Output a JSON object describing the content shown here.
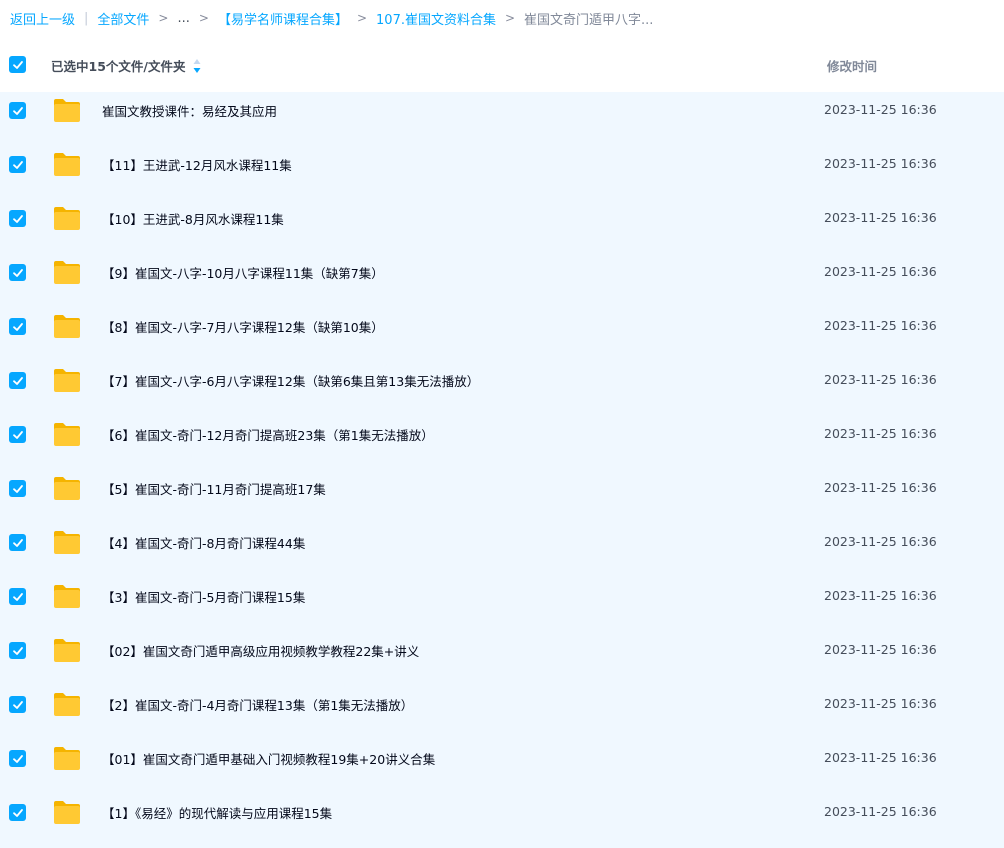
{
  "breadcrumb": {
    "back": "返回上一级",
    "sep": "|",
    "all_files": "全部文件",
    "ellipsis": "...",
    "crumb1": "【易学名师课程合集】",
    "crumb2": "107.崔国文资料合集",
    "current": "崔国文奇门遁甲八字...",
    "arrow": ">"
  },
  "header": {
    "selected_label": "已选中15个文件/文件夹",
    "time_column": "修改时间"
  },
  "colors": {
    "accent": "#06a7ff",
    "row_selected_bg": "#f0f8ff",
    "folder": "#ffc933"
  },
  "files": [
    {
      "name": "崔国文教授课件：易经及其应用",
      "time": "2023-11-25 16:36",
      "icon": "folder-icon"
    },
    {
      "name": "【11】王进武-12月风水课程11集",
      "time": "2023-11-25 16:36",
      "icon": "folder-icon"
    },
    {
      "name": "【10】王进武-8月风水课程11集",
      "time": "2023-11-25 16:36",
      "icon": "folder-icon"
    },
    {
      "name": "【9】崔国文-八字-10月八字课程11集（缺第7集）",
      "time": "2023-11-25 16:36",
      "icon": "folder-icon"
    },
    {
      "name": "【8】崔国文-八字-7月八字课程12集（缺第10集）",
      "time": "2023-11-25 16:36",
      "icon": "folder-icon"
    },
    {
      "name": "【7】崔国文-八字-6月八字课程12集（缺第6集且第13集无法播放）",
      "time": "2023-11-25 16:36",
      "icon": "folder-icon"
    },
    {
      "name": "【6】崔国文-奇门-12月奇门提高班23集（第1集无法播放）",
      "time": "2023-11-25 16:36",
      "icon": "folder-icon"
    },
    {
      "name": "【5】崔国文-奇门-11月奇门提高班17集",
      "time": "2023-11-25 16:36",
      "icon": "folder-icon"
    },
    {
      "name": "【4】崔国文-奇门-8月奇门课程44集",
      "time": "2023-11-25 16:36",
      "icon": "folder-icon"
    },
    {
      "name": "【3】崔国文-奇门-5月奇门课程15集",
      "time": "2023-11-25 16:36",
      "icon": "folder-icon"
    },
    {
      "name": "【02】崔国文奇门遁甲高级应用视频教学教程22集+讲义",
      "time": "2023-11-25 16:36",
      "icon": "folder-icon"
    },
    {
      "name": "【2】崔国文-奇门-4月奇门课程13集（第1集无法播放）",
      "time": "2023-11-25 16:36",
      "icon": "folder-icon"
    },
    {
      "name": "【01】崔国文奇门遁甲基础入门视频教程19集+20讲义合集",
      "time": "2023-11-25 16:36",
      "icon": "folder-icon"
    },
    {
      "name": "【1】《易经》的现代解读与应用课程15集",
      "time": "2023-11-25 16:36",
      "icon": "folder-icon"
    }
  ]
}
